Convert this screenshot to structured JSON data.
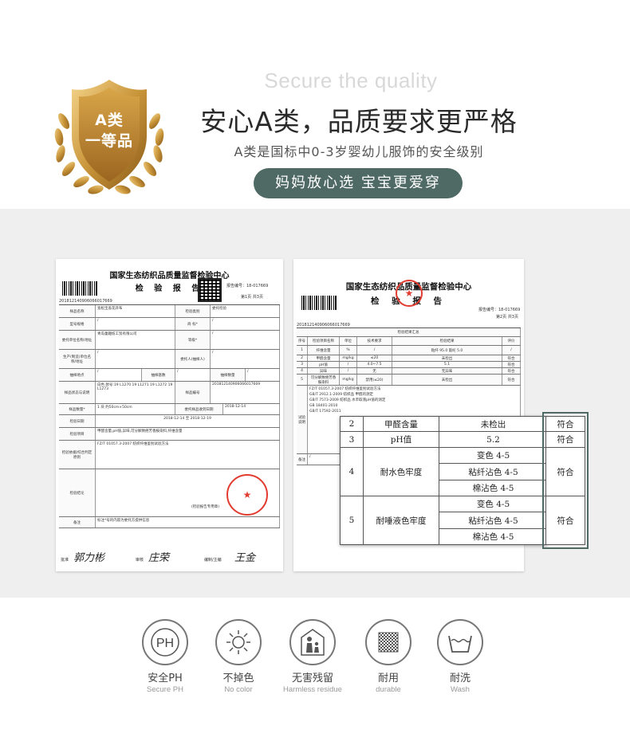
{
  "badge": {
    "line1": "A类",
    "line2": "一等品"
  },
  "header": {
    "en_title": "Secure the quality",
    "main_title": "安心A类，品质要求更严格",
    "sub_title": "A类是国标中0-3岁婴幼儿服饰的安全级别",
    "pill_label": "妈妈放心选 宝宝更爱穿"
  },
  "doc1": {
    "title": "国家生态纺织品质量监督检验中心",
    "subtitle": "检 验 报 告",
    "report_no": "报告编号：18-017669",
    "page": "第1页 共3页",
    "code": "201812140906066017669",
    "fields": [
      {
        "label": "样品名称",
        "value": "宽松宝盖花开布"
      },
      {
        "label": "型号规格",
        "value": "/"
      },
      {
        "label": "委托单位名称/地址",
        "value": "青岛童趣纺工贸有限公司"
      },
      {
        "label": "生产(制造)单位名称/地址",
        "value": "/"
      },
      {
        "label": "样品批号",
        "value": "/"
      },
      {
        "label": "样品状态与说明",
        "value": "白色 款号:19 L1270 19 L1271 19 L1272 19 L1273"
      },
      {
        "label": "检验日期",
        "value": "2018-12-14 至 2018-12-19"
      },
      {
        "label": "检验项目",
        "value": "甲醛含量,pH值,异味,可分解致癌芳香胺染料,纤维含量"
      },
      {
        "label": "检验依据/综合判定原则",
        "value": "FZ/T 01057.3-2007 纺织纤维鉴别试验方法"
      },
      {
        "label": "检验结论",
        "value": "(检验报告专用章)"
      },
      {
        "label": "备注",
        "value": "标注*号的内容为委托方提供信息"
      }
    ],
    "stamp_text": "电子专用章",
    "signatures": {
      "approve_label": "批准",
      "approve": "郭力彬",
      "review_label": "审核",
      "review": "庄荣",
      "prepare_label": "编制/主编",
      "prepare": "王金"
    }
  },
  "doc2": {
    "title": "国家生态纺织品质量监督检验中心",
    "subtitle": "检 验 报 告",
    "report_no": "报告编号：18-017669",
    "page": "第2页 共3页",
    "code": "201812140906066017669",
    "table_header": "检验结果汇总",
    "columns": [
      "序号",
      "检验项目名称",
      "单位",
      "技术要求",
      "检验结果",
      "评价"
    ],
    "rows": [
      {
        "no": "1",
        "item": "纤维含量",
        "unit": "%",
        "req": "/",
        "result": "粘纤 95.0 氨纶 5.0",
        "eval": "/"
      },
      {
        "no": "2",
        "item": "甲醛含量",
        "unit": "mg/kg",
        "req": "≤20",
        "result": "未检出",
        "eval": "符合"
      },
      {
        "no": "3",
        "item": "pH值",
        "unit": "/",
        "req": "4.0~7.5",
        "result": "5.1",
        "eval": "符合"
      },
      {
        "no": "4",
        "item": "异味",
        "unit": "/",
        "req": "无",
        "result": "无异味",
        "eval": "符合"
      },
      {
        "no": "5",
        "item": "可分解致癌芳香胺染料",
        "unit": "mg/kg",
        "req": "禁用(≤20)",
        "result": "未检出",
        "eval": "符合"
      }
    ],
    "method_label": "试验说明",
    "remark_label": "备注"
  },
  "zoom_table": {
    "rows": [
      {
        "no": "2",
        "item": "甲醛含量",
        "results": [
          "未检出"
        ],
        "eval": "符合"
      },
      {
        "no": "3",
        "item": "pH值",
        "results": [
          "5.2"
        ],
        "eval": "符合"
      },
      {
        "no": "4",
        "item": "耐水色牢度",
        "results": [
          "变色 4-5",
          "粘纤沾色 4-5",
          "棉沾色 4-5"
        ],
        "eval": "符合"
      },
      {
        "no": "5",
        "item": "耐唾液色牢度",
        "results": [
          "变色 4-5",
          "粘纤沾色 4-5",
          "棉沾色 4-5"
        ],
        "eval": "符合"
      }
    ]
  },
  "features": [
    {
      "icon": "ph-icon",
      "label": "安全PH",
      "sub": "Secure PH",
      "glyph": "PH"
    },
    {
      "icon": "sun-icon",
      "label": "不掉色",
      "sub": "No color"
    },
    {
      "icon": "family-icon",
      "label": "无害残留",
      "sub": "Harmless residue"
    },
    {
      "icon": "fabric-icon",
      "label": "耐用",
      "sub": "durable"
    },
    {
      "icon": "wash-icon",
      "label": "耐洗",
      "sub": "Wash"
    }
  ],
  "colors": {
    "accent": "#4f6a64",
    "gold": "#c9953a",
    "stamp_red": "#e23b2f",
    "bg_gray": "#efefef"
  }
}
